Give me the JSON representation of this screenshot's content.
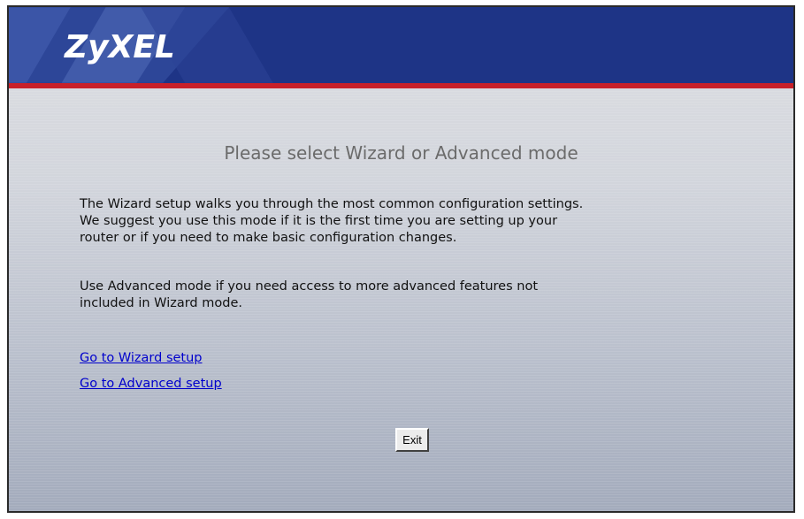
{
  "header": {
    "logo_text": "ZyXEL",
    "colors": {
      "header_bg": "#1e3486",
      "header_stripe": "#c8202a",
      "logo_text": "#ffffff"
    }
  },
  "main": {
    "title": "Please select Wizard or Advanced mode",
    "paragraph_wizard": "The Wizard setup walks you through the most common configuration settings.\nWe suggest you use this mode if it is the first time you are setting up your\nrouter or if you need to make basic configuration changes.",
    "paragraph_advanced": "Use Advanced mode if you need access to more advanced features not\nincluded in Wizard mode.",
    "links": {
      "wizard_label": "Go to Wizard setup",
      "advanced_label": "Go to Advanced setup"
    },
    "exit_label": "Exit",
    "colors": {
      "title": "#6b6b6b",
      "link": "#0000cc"
    }
  }
}
